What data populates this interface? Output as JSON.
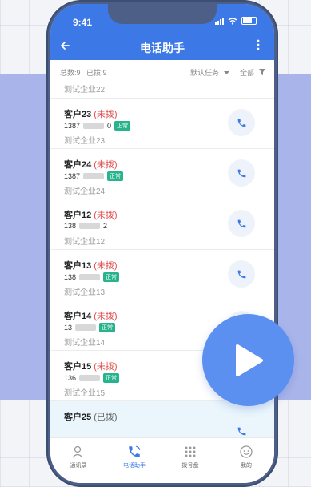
{
  "status_bar": {
    "time": "9:41"
  },
  "nav": {
    "title": "电话助手"
  },
  "filter": {
    "total_label": "总数:9",
    "dialed_label": "已拨:9",
    "task_label": "默认任务",
    "all_label": "全部"
  },
  "partial_top": {
    "company": "测试企业22"
  },
  "contacts": [
    {
      "name": "客户23",
      "status": "(未拨)",
      "phone_prefix": "1387",
      "phone_suffix": "0",
      "tag": "正常",
      "company": "测试企业23"
    },
    {
      "name": "客户24",
      "status": "(未拨)",
      "phone_prefix": "1387",
      "phone_suffix": "",
      "tag": "正常",
      "company": "测试企业24"
    },
    {
      "name": "客户12",
      "status": "(未拨)",
      "phone_prefix": "138",
      "phone_suffix": "2",
      "tag": "正常",
      "company": "测试企业12"
    },
    {
      "name": "客户13",
      "status": "(未拨)",
      "phone_prefix": "138",
      "phone_suffix": "",
      "tag": "正常",
      "company": "测试企业13"
    },
    {
      "name": "客户14",
      "status": "(未拨)",
      "phone_prefix": "13",
      "phone_suffix": "",
      "tag": "正常",
      "company": "测试企业14"
    },
    {
      "name": "客户15",
      "status": "(未拨)",
      "phone_prefix": "136",
      "phone_suffix": "",
      "tag": "正常",
      "company": "测试企业15"
    },
    {
      "name": "客户25",
      "status": "(已拨)",
      "phone_prefix": "",
      "phone_suffix": "",
      "tag": "",
      "company": ""
    }
  ],
  "tabs": [
    {
      "label": "通讯录"
    },
    {
      "label": "电话助手"
    },
    {
      "label": "拨号盘"
    },
    {
      "label": "我的"
    }
  ],
  "colors": {
    "primary": "#3c78e6",
    "undialed": "#e04a4a",
    "tag": "#27b38b",
    "play_button": "#5b8ff0"
  }
}
